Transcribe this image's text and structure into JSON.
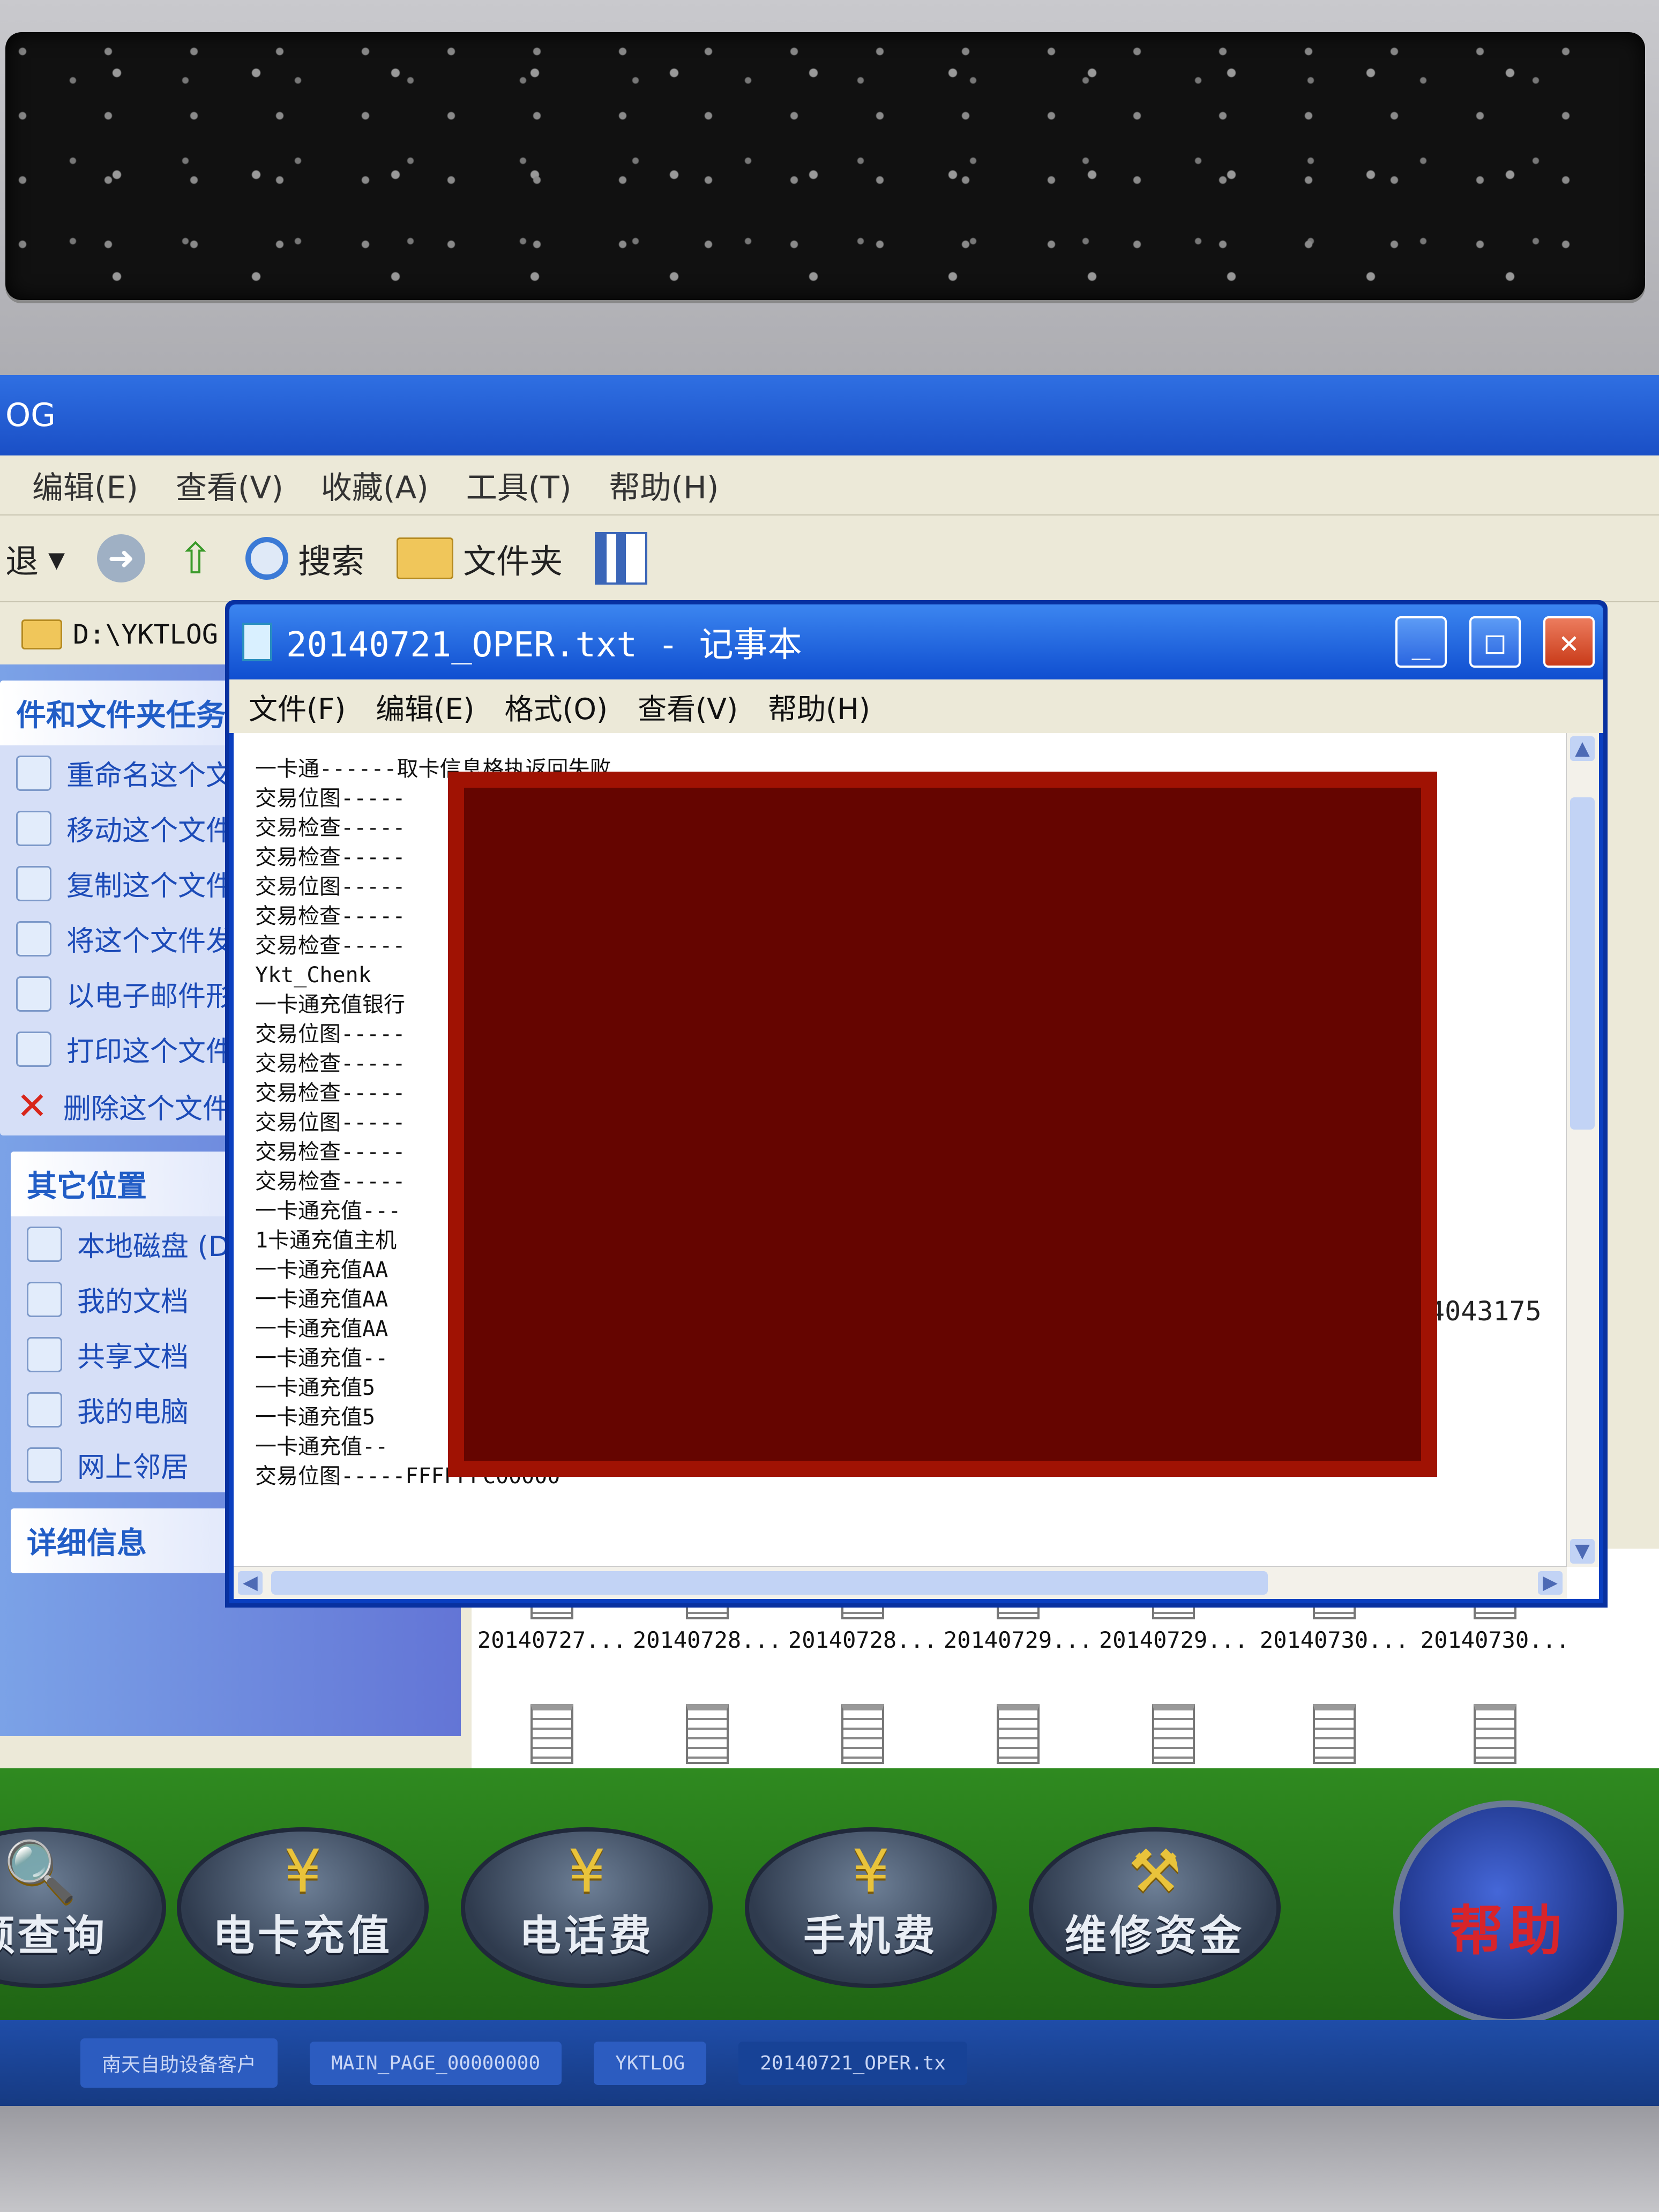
{
  "explorer": {
    "title": "OG",
    "menu": [
      "编辑(E)",
      "查看(V)",
      "收藏(A)",
      "工具(T)",
      "帮助(H)"
    ],
    "toolbar": {
      "back": "退",
      "search": "搜索",
      "folders": "文件夹"
    },
    "address": "D:\\YKTLOG",
    "file_tasks": {
      "header": "件和文件夹任务",
      "items": [
        "重命名这个文件",
        "移动这个文件",
        "复制这个文件",
        "将这个文件发布到",
        "以电子邮件形式发送文件",
        "打印这个文件",
        "删除这个文件"
      ]
    },
    "other_places": {
      "header": "其它位置",
      "items": [
        "本地磁盘 (D:)",
        "我的文档",
        "共享文档",
        "我的电脑",
        "网上邻居"
      ]
    },
    "details": {
      "header": "详细信息"
    },
    "files": [
      "20140727...",
      "20140728...",
      "20140728...",
      "20140729...",
      "20140729...",
      "20140730...",
      "20140730..."
    ]
  },
  "notepad": {
    "title": "20140721_OPER.txt - 记事本",
    "menu": [
      "文件(F)",
      "编辑(E)",
      "格式(O)",
      "查看(V)",
      "帮助(H)"
    ],
    "lines": [
      "一卡通------取卡信息格执返回失败",
      "交易位图-----",
      "交易检查-----",
      "交易检查-----",
      "交易位图-----",
      "交易检查-----",
      "交易检查-----",
      "Ykt_Chenk",
      "一卡通充值银行",
      "交易位图-----",
      "交易检查-----",
      "交易检查-----",
      "交易位图-----",
      "交易检查-----",
      "交易检查-----",
      "一卡通充值---",
      "1卡通充值主机",
      "一卡通充值AA",
      "一卡通充值AA",
      "一卡通充值AA",
      "一卡通充值--",
      "一卡通充值5",
      "一卡通充值5",
      "一卡通充值--",
      "交易位图-----FFFFFFC00000"
    ],
    "trailing_value": "4043175"
  },
  "kiosk": {
    "buttons": [
      "额查询",
      "电卡充值",
      "电话费",
      "手机费",
      "维修资金"
    ],
    "help": "帮助"
  },
  "taskbar": [
    "南天自助设备客户",
    "MAIN_PAGE_00000000",
    "YKTLOG",
    "20140721_OPER.tx"
  ],
  "colors": {
    "redaction": "#650500",
    "redaction_border": "#a01203",
    "xp_blue": "#0a3fc0"
  }
}
